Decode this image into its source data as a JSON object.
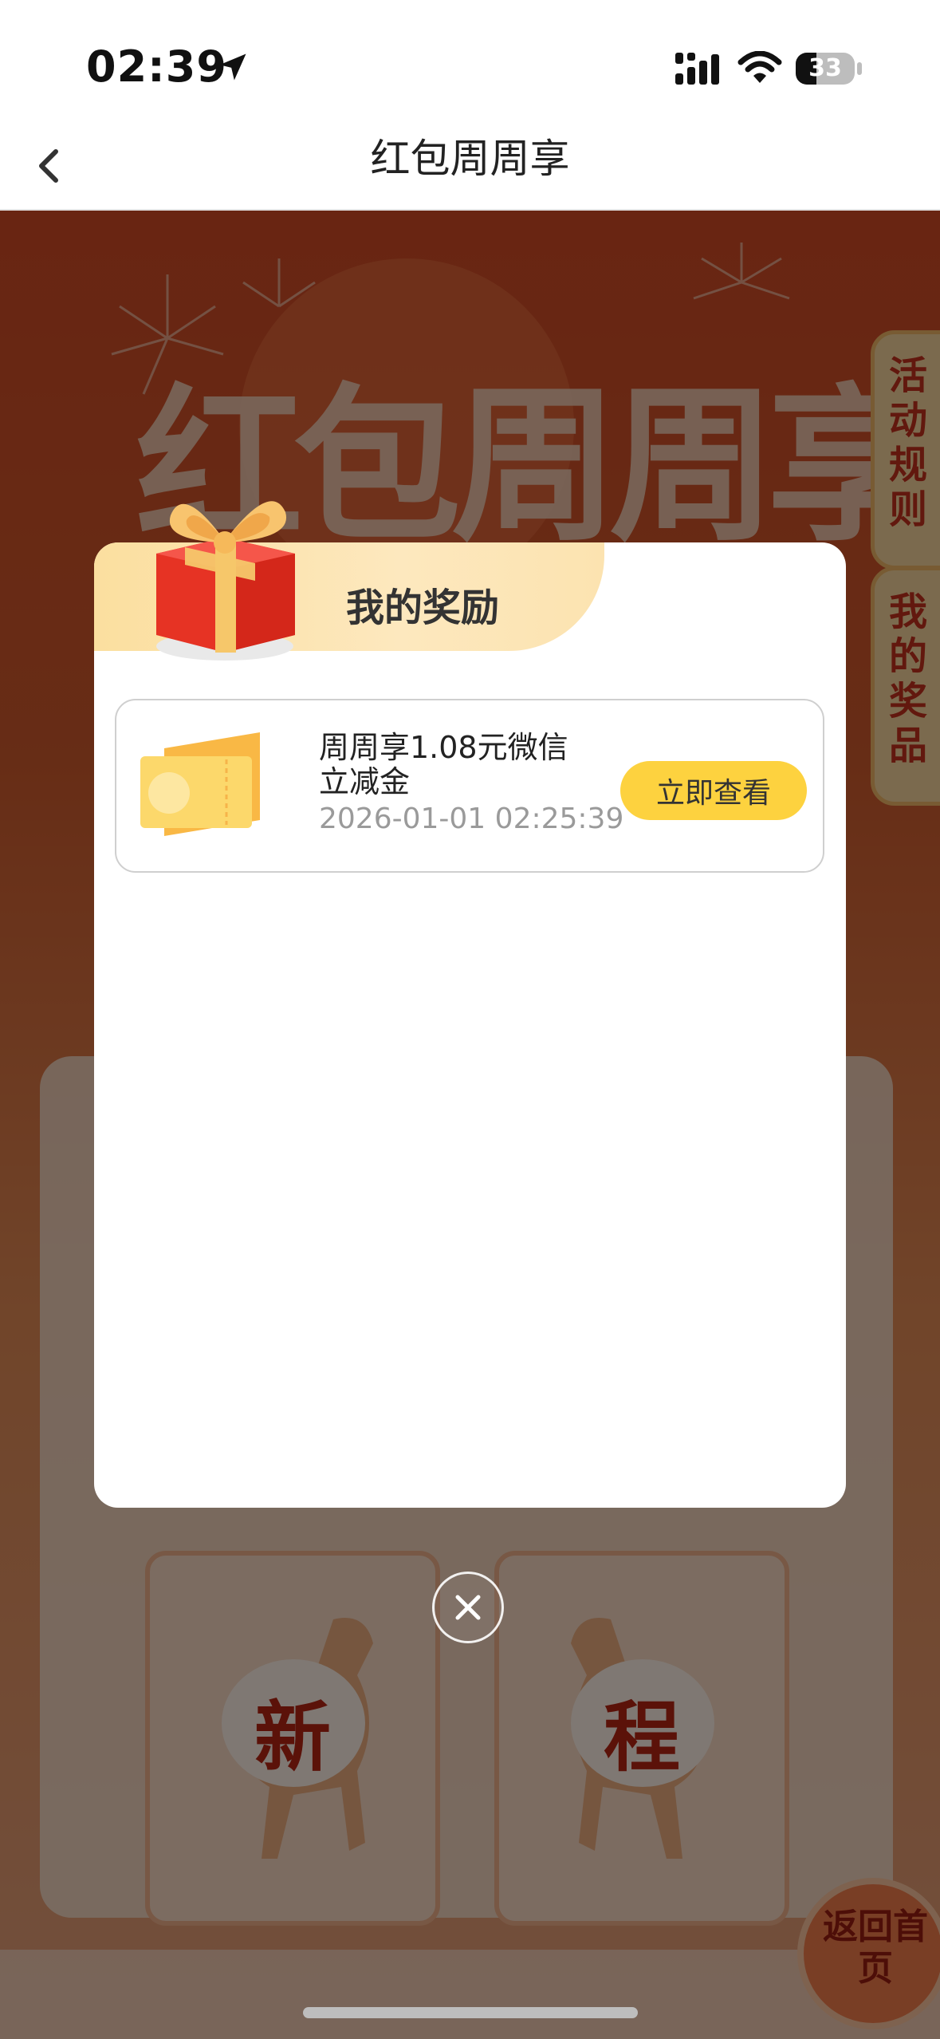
{
  "status_bar": {
    "time": "02:39",
    "battery": "33",
    "icons": [
      "location-arrow-icon",
      "signal-icon",
      "wifi-icon",
      "battery-icon"
    ]
  },
  "nav": {
    "title": "红包周周享",
    "back_icon": "chevron-left-icon"
  },
  "background": {
    "banner_title": "红包周周享",
    "side_tabs": [
      "活动规则",
      "我的奖品"
    ],
    "cards": [
      "新",
      "程"
    ],
    "home_button": "返回首页"
  },
  "modal": {
    "title": "我的奖励",
    "rewards": [
      {
        "name": "周周享1.08元微信立减金",
        "time": "2026-01-01 02:25:39",
        "action": "立即查看"
      }
    ],
    "close_icon": "close-circle-icon"
  },
  "colors": {
    "accent_yellow": "#fdd23f",
    "header_gold": "#fbdf9f",
    "festive_red": "#d24a25"
  }
}
